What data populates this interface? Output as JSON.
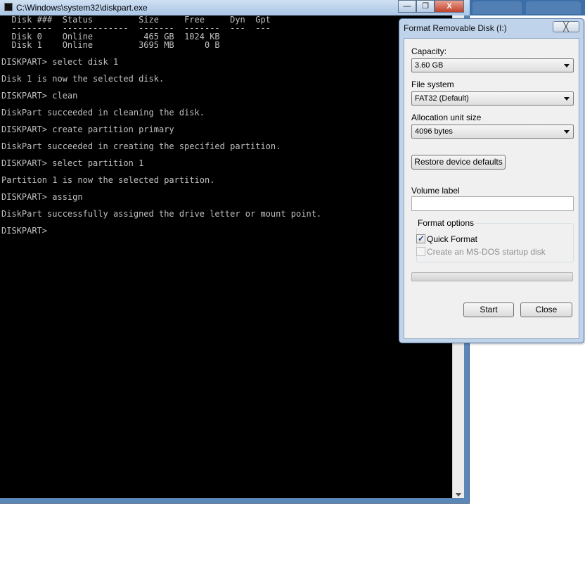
{
  "console": {
    "title": "C:\\Windows\\system32\\diskpart.exe",
    "lines": [
      "  Disk ###  Status         Size     Free     Dyn  Gpt",
      "  --------  -------------  -------  -------  ---  ---",
      "  Disk 0    Online          465 GB  1024 KB",
      "  Disk 1    Online         3695 MB      0 B",
      "",
      "DISKPART> select disk 1",
      "",
      "Disk 1 is now the selected disk.",
      "",
      "DISKPART> clean",
      "",
      "DiskPart succeeded in cleaning the disk.",
      "",
      "DISKPART> create partition primary",
      "",
      "DiskPart succeeded in creating the specified partition.",
      "",
      "DISKPART> select partition 1",
      "",
      "Partition 1 is now the selected partition.",
      "",
      "DISKPART> assign",
      "",
      "DiskPart successfully assigned the drive letter or mount point.",
      "",
      "DISKPART>"
    ],
    "minimize_glyph": "—",
    "maximize_glyph": "❐",
    "close_glyph": "X"
  },
  "dialog": {
    "title": "Format Removable Disk (I:)",
    "close_glyph": "╳",
    "capacity_label": "Capacity:",
    "capacity_value": "3.60 GB",
    "filesystem_label": "File system",
    "filesystem_value": "FAT32 (Default)",
    "alloc_label": "Allocation unit size",
    "alloc_value": "4096 bytes",
    "restore_button": "Restore device defaults",
    "volume_label": "Volume label",
    "volume_value": "",
    "format_options_title": "Format options",
    "quick_format_label": "Quick Format",
    "quick_format_checked": true,
    "msdos_label": "Create an MS-DOS startup disk",
    "msdos_checked": false,
    "progress": 0,
    "start_button": "Start",
    "close_button": "Close"
  }
}
